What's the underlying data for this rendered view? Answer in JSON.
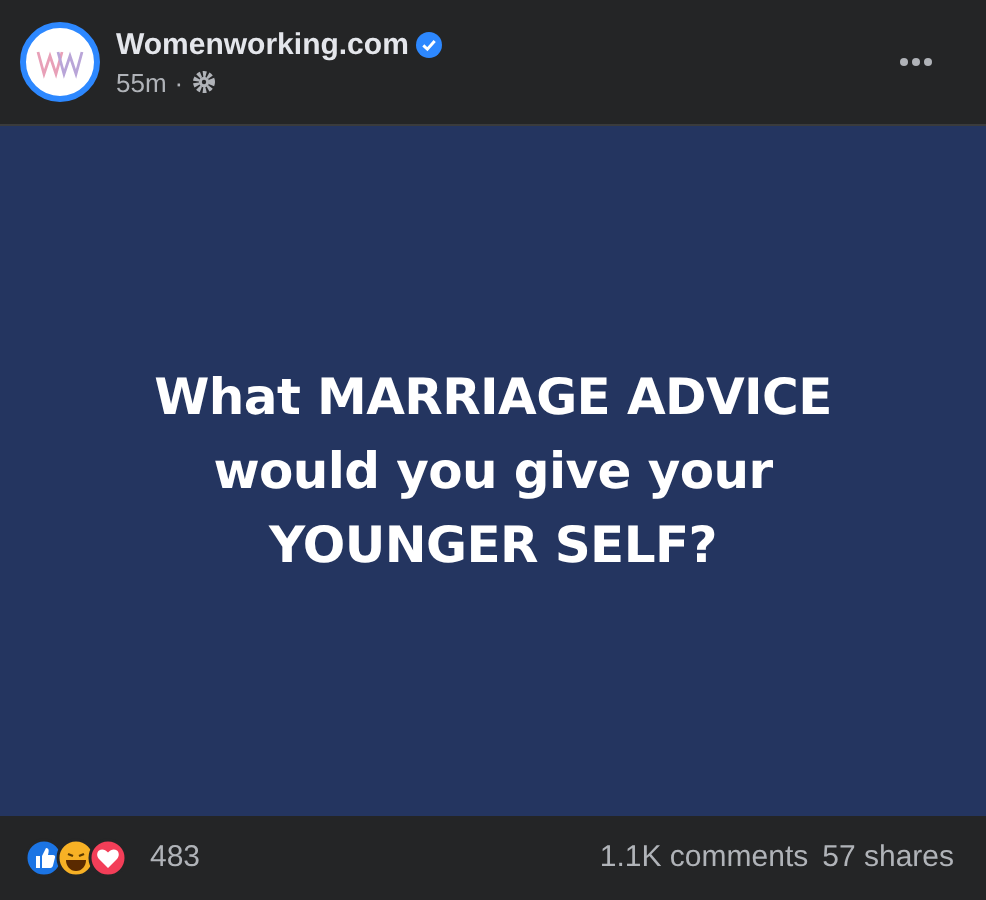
{
  "post": {
    "author": "Womenworking.com",
    "verified": true,
    "time": "55m",
    "separator": "·",
    "image_text": [
      "What MARRIAGE ADVICE",
      "would you give your",
      "YOUNGER SELF?"
    ],
    "reaction_count": "483",
    "comments": "1.1K comments",
    "shares": "57 shares"
  }
}
